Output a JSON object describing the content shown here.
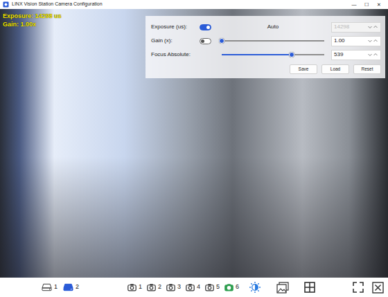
{
  "window": {
    "title": "LINX Vision Station Camera Configuration",
    "controls": [
      "—",
      "☐",
      "✕"
    ]
  },
  "overlay": {
    "lines": [
      "Exposure: 14298 us",
      "Gain: 1.00x"
    ]
  },
  "settings": {
    "rows": [
      {
        "kind": "auto",
        "label": "Exposure (us):",
        "on": true,
        "mode": "Auto",
        "value": "14298",
        "disabled": true
      },
      {
        "kind": "slider",
        "label": "Gain (x):",
        "on": false,
        "level": 0.0,
        "value": "1.00",
        "disabled": false
      },
      {
        "kind": "plain",
        "label": "Focus Absolute:",
        "level": 0.68,
        "value": "539",
        "disabled": false
      }
    ],
    "buttons": [
      "Save",
      "Load",
      "Reset"
    ]
  },
  "toolbar": {
    "storage": [
      {
        "label": "1",
        "selected": false
      },
      {
        "label": "2",
        "selected": true
      }
    ],
    "cameras": [
      {
        "label": "1",
        "selected": false
      },
      {
        "label": "2",
        "selected": false
      },
      {
        "label": "3",
        "selected": false
      },
      {
        "label": "4",
        "selected": false
      },
      {
        "label": "5",
        "selected": false
      },
      {
        "label": "6",
        "selected": true
      }
    ],
    "tools": [
      {
        "kind": "brightness",
        "selected": true
      },
      {
        "kind": "image",
        "selected": false
      },
      {
        "kind": "grid",
        "selected": false
      },
      {
        "kind": "fullscreen",
        "selected": false
      },
      {
        "kind": "close",
        "selected": false
      }
    ]
  }
}
